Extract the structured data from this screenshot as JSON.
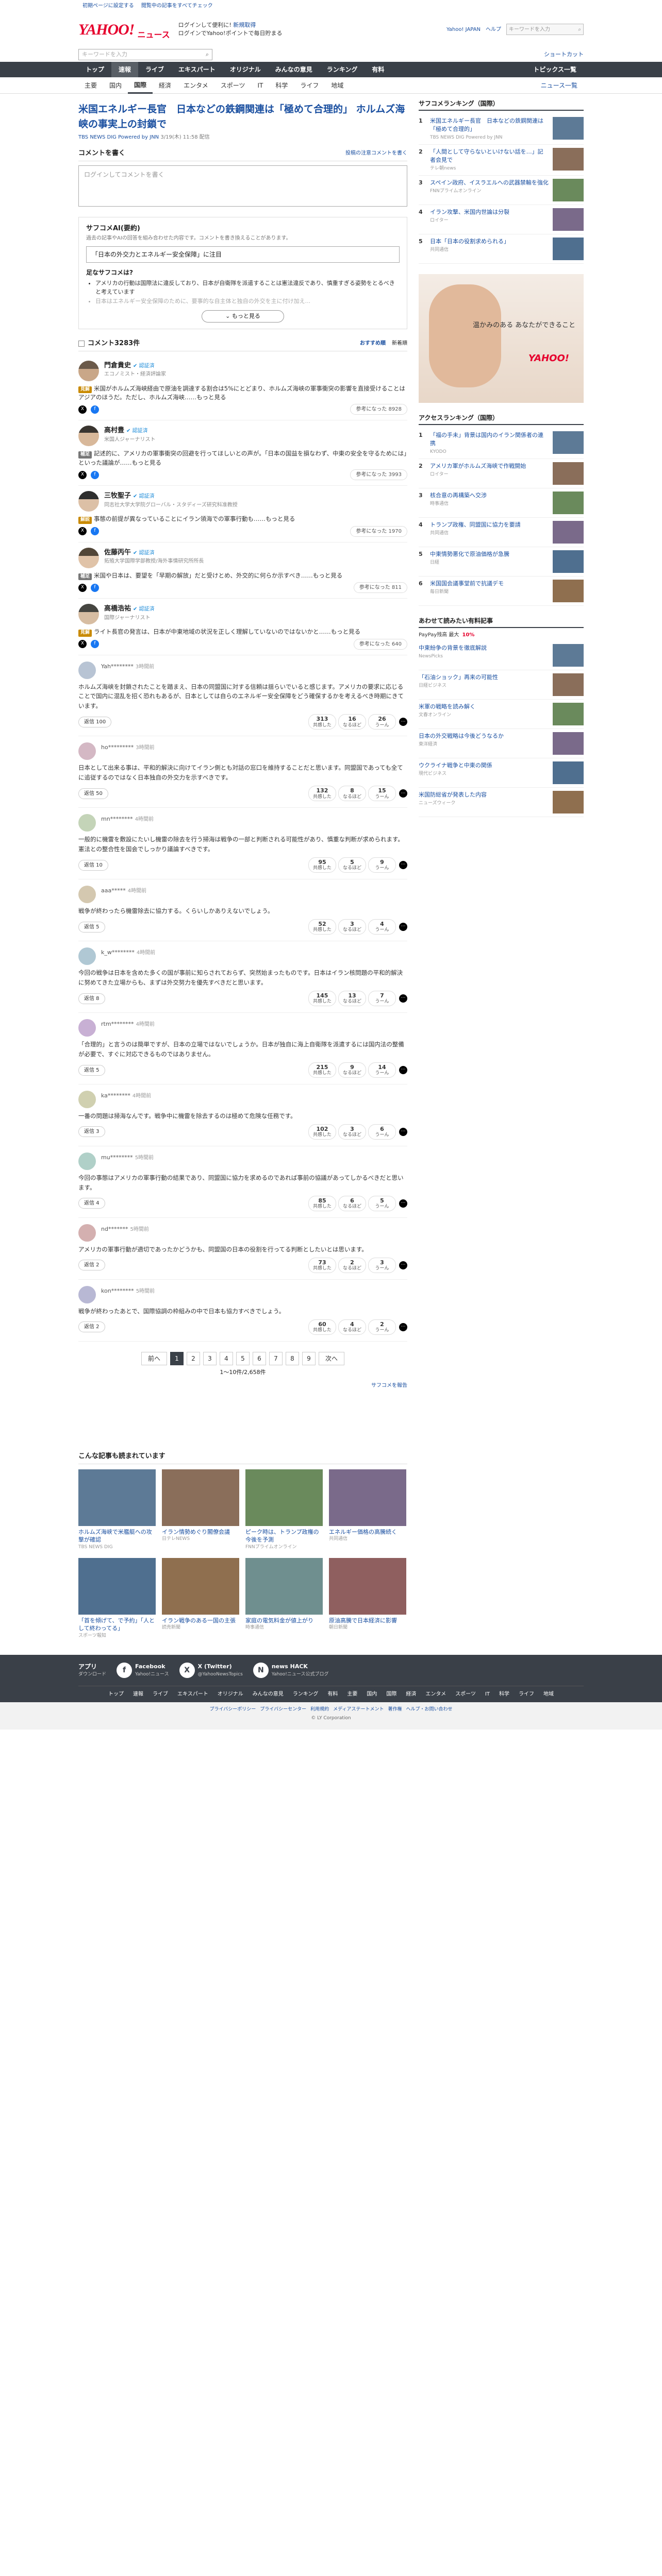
{
  "toplinks": [
    "初期ページに設定する",
    "閲覧中の記事をすべてチェック"
  ],
  "brand": {
    "logo": "YAHOO!",
    "sub": "ニュース"
  },
  "header": {
    "line1": "ログインして便利に!",
    "promo": "新規取得",
    "line2": "ログインでYahoo!ポイントで毎日貯まる",
    "line3": "Yahoo! JAPAN",
    "help": "ヘルプ",
    "search_placeholder": "キーワードを入力",
    "search_btn": "検索",
    "shortcut": "ショートカット"
  },
  "nav": [
    "トップ",
    "速報",
    "ライブ",
    "エキスパート",
    "オリジナル",
    "みんなの意見",
    "ランキング",
    "有料"
  ],
  "nav_right": "トピックス一覧",
  "subnav": [
    "主要",
    "国内",
    "国際",
    "経済",
    "エンタメ",
    "スポーツ",
    "IT",
    "科学",
    "ライフ",
    "地域"
  ],
  "subnav_right": "ニュース一覧",
  "article": {
    "title": "米国エネルギー長官　日本などの鉄鋼関連は「極めて合理的」 ホルムズ海峡の事実上の封鎖で",
    "source": "TBS NEWS DIG Powered by JNN",
    "date": "3/19(木) 11:58 配信"
  },
  "comment_post": {
    "label": "コメントを書く",
    "link": "投稿の注意コメントを書く",
    "placeholder": "ログインしてコメントを書く"
  },
  "ai": {
    "title": "サフコメAI(要約)",
    "desc": "過去の記事やAIの回答を組み合わせた内容です。コメントを書き換えることがあります。",
    "quote": "「日本の外交力とエネルギー安全保障」に注目",
    "question": "足なサフコメは?",
    "points": [
      "アメリカの行動は国際法に違反しており、日本が自衛隊を派遣することは憲法違反であり、慎重すぎる姿勢をとるべきと考えています",
      "日本はエネルギー安全保障のために、要事的な自主体と独自の外交を主に付け加え..."
    ],
    "more": "もっと見る"
  },
  "comments_head": {
    "title": "コメント3283件",
    "sort_label": "おすすめ順",
    "sort_new": "新着順"
  },
  "experts": [
    {
      "name": "門倉貴史",
      "role": "エコノミスト・経済評論家",
      "tag": "見解",
      "body": "米国がホルムズ海峡経由で原油を調達する割合は5%にとどまり、ホルムズ海峡の軍事衝突の影響を直接受けることはアジアのほうだ。ただし、ホルムズ海峡……もっと見る",
      "helpful": "参考になった 8928"
    },
    {
      "name": "高村豊",
      "role": "米国人ジャーナリスト",
      "tag": "補足",
      "body": "記述的に、アメリカの軍事衝突の回避を行ってほしいとの声が。「日本の国益を損なわず、中東の安全を守るためには」といった議論が……もっと見る",
      "helpful": "参考になった 3993"
    },
    {
      "name": "三牧聖子",
      "role": "同志社大学大学院グローバル・スタディーズ研究科准教授",
      "tag": "解説",
      "body": "事態の前提が異なっていることにイラン領海での軍事行動も……もっと見る",
      "helpful": "参考になった 1970"
    },
    {
      "name": "佐藤丙午",
      "role": "拓殖大学国際学部教授/海外事情研究所所長",
      "tag": "補足",
      "body": "米国や日本は、要望を「早期の解放」だと受けとめ、外交的に何らか示すべき……もっと見る",
      "helpful": "参考になった 811"
    },
    {
      "name": "高橋浩祐",
      "role": "国際ジャーナリスト",
      "tag": "見解",
      "body": "ライト長官の発言は、日本が中東地域の状況を正しく理解していないのではないかと……もっと見る",
      "helpful": "参考になった 640"
    }
  ],
  "user_comments": [
    {
      "replied": "",
      "name": "Yah********",
      "date": "3時間前",
      "body": "ホルムズ海峡を封鎖されたことを踏まえ、日本の同盟国に対する信頼は揺らいでいると感じます。アメリカの要求に応じることで国内に混乱を招く恐れもあるが、日本としては自らのエネルギー安全保障をどう確保するかを考えるべき時期にきています。",
      "replies": "返信 100",
      "r1": "313",
      "r2": "16",
      "r3": "26"
    },
    {
      "replied": "",
      "name": "ho*********",
      "date": "3時間前",
      "body": "日本として出来る事は、平和的解決に向けてイラン側とも対話の窓口を維持することだと思います。同盟国であっても全てに追従するのではなく日本独自の外交力を示すべきです。",
      "replies": "返信 50",
      "r1": "132",
      "r2": "8",
      "r3": "15"
    },
    {
      "replied": "",
      "name": "mn********",
      "date": "4時間前",
      "body": "一般的に機雷を敷設にたいし機雷の除去を行う掃海は戦争の一部と判断される可能性があり、慎重な判断が求められます。憲法との整合性を国会でしっかり議論すべきです。",
      "replies": "返信 10",
      "r1": "95",
      "r2": "5",
      "r3": "9"
    },
    {
      "replied": "",
      "name": "aaa*****",
      "date": "4時間前",
      "body": "戦争が終わったら機雷除去に協力する。くらいしかありえないでしょう。",
      "replies": "返信 5",
      "r1": "52",
      "r2": "3",
      "r3": "4"
    },
    {
      "replied": "",
      "name": "k_w********",
      "date": "4時間前",
      "body": "今回の戦争は日本を含めた多くの国が事前に知らされておらず、突然始まったものです。日本はイラン核問題の平和的解決に努めてきた立場からも、まずは外交努力を優先すべきだと思います。",
      "replies": "返信 8",
      "r1": "145",
      "r2": "13",
      "r3": "7"
    },
    {
      "replied": "",
      "name": "rtm********",
      "date": "4時間前",
      "body": "「合理的」と言うのは簡単ですが、日本の立場ではないでしょうか。日本が独自に海上自衛隊を派遣するには国内法の整備が必要で、すぐに対応できるものではありません。",
      "replies": "返信 5",
      "r1": "215",
      "r2": "9",
      "r3": "14"
    },
    {
      "replied": "",
      "name": "ka********",
      "date": "4時間前",
      "body": "一番の問題は掃海なんです。戦争中に機雷を除去するのは極めて危険な任務です。",
      "replies": "返信 3",
      "r1": "102",
      "r2": "3",
      "r3": "6"
    },
    {
      "replied": "",
      "name": "mu********",
      "date": "5時間前",
      "body": "今回の事態はアメリカの軍事行動の結果であり、同盟国に協力を求めるのであれば事前の協議があってしかるべきだと思います。",
      "replies": "返信 4",
      "r1": "85",
      "r2": "6",
      "r3": "5"
    },
    {
      "replied": "",
      "name": "nd*******",
      "date": "5時間前",
      "body": "アメリカの軍事行動が適切であったかどうかも、同盟国の日本の役割を行ってる判断としたいとは思います。",
      "replies": "返信 2",
      "r1": "73",
      "r2": "2",
      "r3": "3"
    },
    {
      "replied": "",
      "name": "kon********",
      "date": "5時間前",
      "body": "戦争が終わったあとで、国際協調の枠組みの中で日本も協力すべきでしょう。",
      "replies": "返信 2",
      "r1": "60",
      "r2": "4",
      "r3": "2"
    }
  ],
  "pager": {
    "prev": "前へ",
    "pages": [
      "1",
      "2",
      "3",
      "4",
      "5",
      "6",
      "7",
      "8",
      "9"
    ],
    "next": "次へ",
    "info": "1〜10件/2,658件"
  },
  "report_link": "サフコメを報告",
  "related": {
    "title": "こんな記事も読まれています",
    "items": [
      {
        "cap": "ホルムズ海峡で米艦艇への攻撃が確認",
        "src": "TBS NEWS DIG"
      },
      {
        "cap": "イラン情勢めぐり閣僚会議",
        "src": "日テレNEWS"
      },
      {
        "cap": "ピーク時は、トランプ政権の今後を予測",
        "src": "FNNプライムオンライン"
      },
      {
        "cap": "エネルギー価格の高騰続く",
        "src": "共同通信"
      },
      {
        "cap": "「首を傾げて、で予約」「人として終わってる」",
        "src": "スポーツ報知"
      },
      {
        "cap": "イラン戦争のある一国の主張",
        "src": "読売新聞"
      },
      {
        "cap": "家庭の電気料金が値上がり",
        "src": "時事通信"
      },
      {
        "cap": "原油高騰で日本経済に影響",
        "src": "朝日新聞"
      }
    ]
  },
  "sidebar": {
    "ranking_title": "サフコメランキング（国際）",
    "ranking": [
      {
        "n": "1",
        "t": "米国エネルギー長官　日本などの鉄鋼関連は「極めて合理的」",
        "s": "TBS NEWS DIG Powered by JNN"
      },
      {
        "n": "2",
        "t": "「人間として守らないといけない話を…」記者会見で",
        "s": "テレ朝news"
      },
      {
        "n": "3",
        "t": "スペイン政府、イスラエルへの武器禁輸を強化",
        "s": "FNNプライムオンライン"
      },
      {
        "n": "4",
        "t": "イラン攻撃、米国内世論は分裂",
        "s": "ロイター"
      },
      {
        "n": "5",
        "t": "日本「日本の役割求められる」",
        "s": "共同通信"
      }
    ],
    "ad_text": "温かみのある\nあなたができること",
    "access_title": "アクセスランキング（国際）",
    "access": [
      {
        "n": "1",
        "t": "「福の手未」背景は国内のイラン関係者の連携",
        "s": "KYODO"
      },
      {
        "n": "2",
        "t": "アメリカ軍がホルムズ海峡で作戦開始",
        "s": "ロイター"
      },
      {
        "n": "3",
        "t": "核合意の再構築へ交渉",
        "s": "時事通信"
      },
      {
        "n": "4",
        "t": "トランプ政権、同盟国に協力を要請",
        "s": "共同通信"
      },
      {
        "n": "5",
        "t": "中東情勢悪化で原油価格が急騰",
        "s": "日経"
      },
      {
        "n": "6",
        "t": "米国国会議事堂前で抗議デモ",
        "s": "毎日新聞"
      }
    ],
    "rec_title": "あわせて読みたい有料記事",
    "paypay": "PayPay残高 最大",
    "paypay_pct": "10%",
    "rec": [
      {
        "t": "中東紛争の背景を徹底解説",
        "s": "NewsPicks"
      },
      {
        "t": "「石油ショック」再来の可能性",
        "s": "日経ビジネス"
      },
      {
        "t": "米軍の戦略を読み解く",
        "s": "文春オンライン"
      },
      {
        "t": "日本の外交戦略は今後どうなるか",
        "s": "東洋経済"
      },
      {
        "t": "ウクライナ戦争と中東の関係",
        "s": "現代ビジネス"
      },
      {
        "t": "米国防総省が発表した内容",
        "s": "ニューズウィーク"
      }
    ]
  },
  "footer": {
    "app": "アプリ",
    "app_sub": "ダウンロード",
    "sns": [
      {
        "name": "Facebook",
        "sub": "Yahoo!ニュース",
        "icon": "f"
      },
      {
        "name": "X (Twitter)",
        "sub": "@YahooNewsTopics",
        "icon": "X"
      },
      {
        "name": "news HACK",
        "sub": "Yahoo!ニュース公式ブログ",
        "icon": "N"
      }
    ],
    "links": [
      "トップ",
      "速報",
      "ライブ",
      "エキスパート",
      "オリジナル",
      "みんなの意見",
      "ランキング",
      "有料",
      "主要",
      "国内",
      "国際",
      "経済",
      "エンタメ",
      "スポーツ",
      "IT",
      "科学",
      "ライフ",
      "地域"
    ],
    "bottom_links": [
      "プライバシーポリシー",
      "プライバシーセンター",
      "利用規約",
      "メディアステートメント",
      "著作権",
      "ヘルプ・お問い合わせ"
    ],
    "copyright": "© LY Corporation"
  }
}
